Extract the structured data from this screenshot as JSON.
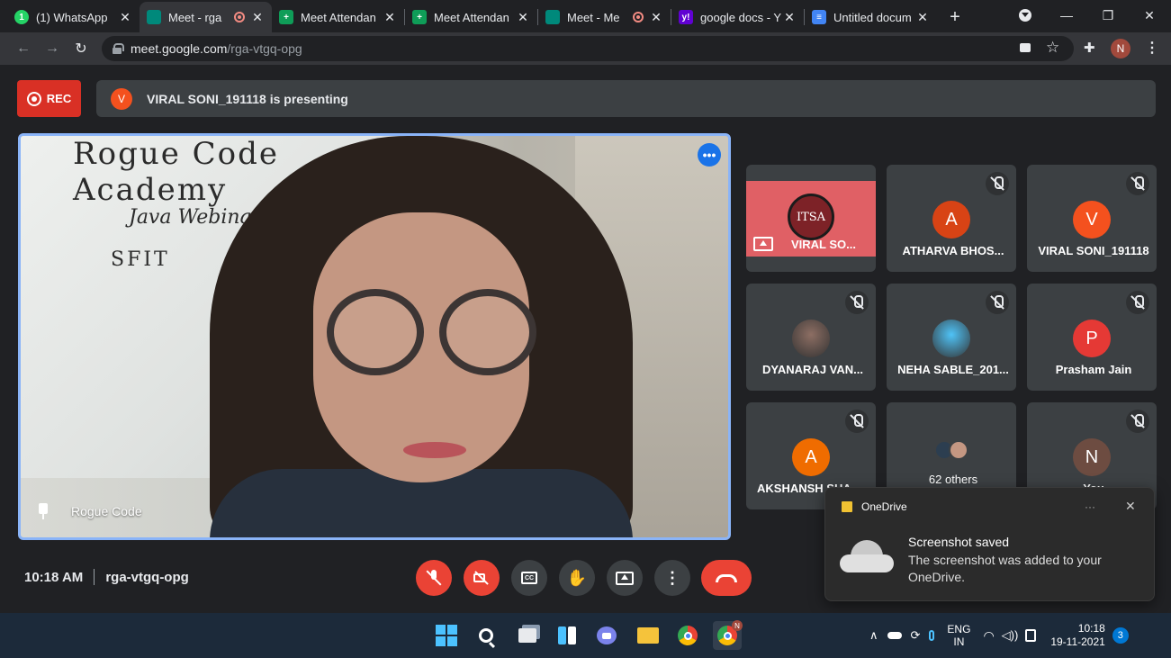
{
  "browser": {
    "tabs": [
      {
        "title": "(1) WhatsApp",
        "favicon": "whatsapp-icon",
        "color": "#25d366",
        "glyph": "1",
        "recording": false,
        "active": false
      },
      {
        "title": "Meet - rga",
        "favicon": "google-meet-icon",
        "color": "#00897b",
        "glyph": "",
        "recording": true,
        "active": true
      },
      {
        "title": "Meet Attendan",
        "favicon": "google-sheets-icon",
        "color": "#0f9d58",
        "glyph": "+",
        "recording": false,
        "active": false
      },
      {
        "title": "Meet Attendan",
        "favicon": "google-sheets-icon",
        "color": "#0f9d58",
        "glyph": "+",
        "recording": false,
        "active": false
      },
      {
        "title": "Meet - Me",
        "favicon": "google-meet-icon",
        "color": "#00897b",
        "glyph": "",
        "recording": true,
        "active": false
      },
      {
        "title": "google docs - Y",
        "favicon": "yahoo-icon",
        "color": "#6001d2",
        "glyph": "y!",
        "recording": false,
        "active": false
      },
      {
        "title": "Untitled docum",
        "favicon": "google-docs-icon",
        "color": "#4285f4",
        "glyph": "≡",
        "recording": false,
        "active": false
      }
    ],
    "url_host": "meet.google.com",
    "url_path": "/rga-vtgq-opg",
    "profile_initial": "N"
  },
  "meet": {
    "rec_label": "REC",
    "presenter_initial": "V",
    "presenting_text": "VIRAL SONI_191118 is presenting",
    "main_tile_name": "Rogue Code",
    "board_lines": [
      "Rogue Code Academy",
      "Java Webinar",
      "SFIT"
    ],
    "participants": [
      {
        "name": "VIRAL SO...",
        "type": "screen",
        "muted": false,
        "color": "#e06065",
        "logo": "ITSA"
      },
      {
        "name": "ATHARVA BHOS...",
        "initial": "A",
        "color": "#d84315",
        "muted": true
      },
      {
        "name": "VIRAL SONI_191118",
        "initial": "V",
        "color": "#f4511e",
        "muted": true
      },
      {
        "name": "DYANARAJ VAN...",
        "initial": "",
        "color": "#8d6e63",
        "muted": true
      },
      {
        "name": "NEHA SABLE_201...",
        "initial": "",
        "color": "#4fc3f7",
        "muted": true
      },
      {
        "name": "Prasham Jain",
        "initial": "P",
        "color": "#e53935",
        "muted": true
      },
      {
        "name": "AKSHANSH SHA...",
        "initial": "A",
        "color": "#ef6c00",
        "muted": true
      },
      {
        "name": "62 others",
        "initial": "",
        "color": "#3c4043",
        "muted": false
      },
      {
        "name": "You",
        "initial": "N",
        "color": "#6d4c41",
        "muted": true
      }
    ],
    "time": "10:18 AM",
    "meeting_code": "rga-vtgq-opg",
    "controls": [
      {
        "name": "mic-off-button",
        "icon": "mic-off-icon",
        "color": "#ea4335"
      },
      {
        "name": "camera-off-button",
        "icon": "camera-off-icon",
        "color": "#ea4335"
      },
      {
        "name": "captions-button",
        "icon": "captions-icon",
        "color": "#3c4043"
      },
      {
        "name": "raise-hand-button",
        "icon": "hand-icon",
        "color": "#3c4043"
      },
      {
        "name": "present-button",
        "icon": "present-icon",
        "color": "#3c4043"
      },
      {
        "name": "more-options-button",
        "icon": "more-vert-icon",
        "color": "#3c4043"
      },
      {
        "name": "leave-call-button",
        "icon": "hangup-icon",
        "color": "#ea4335"
      }
    ]
  },
  "toast": {
    "app": "OneDrive",
    "title": "Screenshot saved",
    "body": "The screenshot was added to your OneDrive."
  },
  "taskbar": {
    "language_top": "ENG",
    "language_bottom": "IN",
    "clock_time": "10:18",
    "clock_date": "19-11-2021",
    "notification_count": "3"
  }
}
